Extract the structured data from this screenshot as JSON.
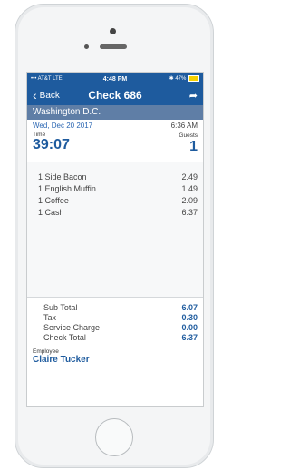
{
  "status_bar": {
    "carrier": "AT&T",
    "network": "LTE",
    "time": "4:48 PM",
    "battery": "47%"
  },
  "nav": {
    "back_label": "Back",
    "title": "Check 686"
  },
  "location": "Washington D.C.",
  "check": {
    "date": "Wed, Dec 20 2017",
    "clock_time": "6:36 AM",
    "time_label": "Time",
    "time_value": "39:07",
    "guests_label": "Guests",
    "guests_value": "1"
  },
  "items": [
    {
      "qty_name": "1 Side Bacon",
      "amount": "2.49"
    },
    {
      "qty_name": "1 English Muffin",
      "amount": "1.49"
    },
    {
      "qty_name": "1 Coffee",
      "amount": "2.09"
    },
    {
      "qty_name": "1 Cash",
      "amount": "6.37"
    }
  ],
  "totals": [
    {
      "label": "Sub Total",
      "value": "6.07"
    },
    {
      "label": "Tax",
      "value": "0.30"
    },
    {
      "label": "Service Charge",
      "value": "0.00"
    },
    {
      "label": "Check Total",
      "value": "6.37"
    }
  ],
  "employee": {
    "label": "Employee",
    "name": "Claire Tucker"
  },
  "colors": {
    "header_blue": "#1e5b9e",
    "location_bar": "#5f7ea6",
    "accent_text": "#2a66b2"
  }
}
